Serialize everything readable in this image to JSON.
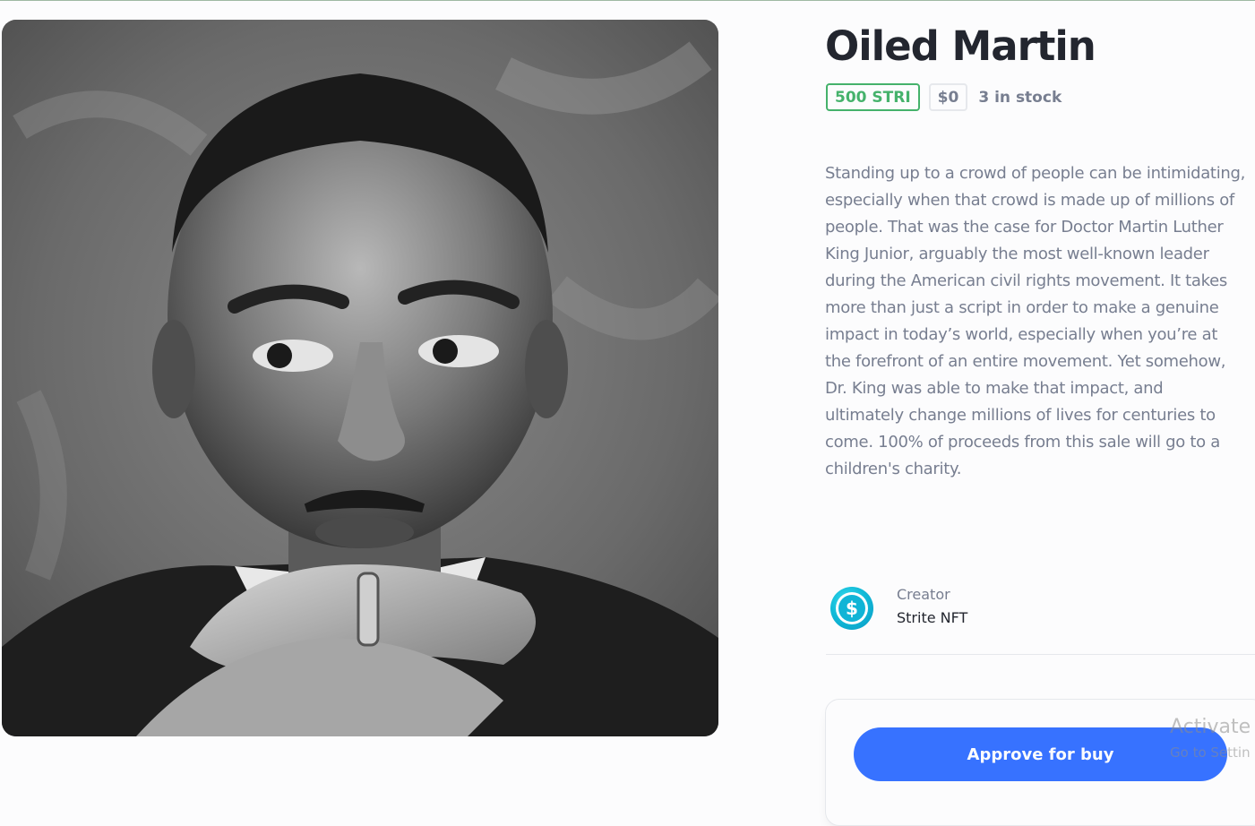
{
  "product": {
    "title": "Oiled Martin",
    "price_token": "500 STRI",
    "price_usd": "$0",
    "stock": "3 in stock",
    "description": "Standing up to a crowd of people can be intimidating, especially when that crowd is made up of millions of people. That was the case for Doctor Martin Luther King Junior, arguably the most well-known leader during the American civil rights movement. It takes more than just a script in order to make a genuine impact in today’s world, especially when you’re at the forefront of an entire movement. Yet somehow, Dr. King was able to make that impact, and ultimately change millions of lives for centuries to come. 100% of proceeds from this sale will go to a children's charity."
  },
  "creator": {
    "role": "Creator",
    "name": "Strite NFT",
    "avatar_symbol": "$",
    "avatar_icon": "dollar-coin-icon"
  },
  "actions": {
    "buy_label": "Approve for buy"
  },
  "os_watermark": {
    "line1": "Activate",
    "line2": "Go to Settin"
  },
  "colors": {
    "accent": "#3772ff",
    "token_price": "#45b26b",
    "muted": "#777e90",
    "heading": "#23262f"
  }
}
